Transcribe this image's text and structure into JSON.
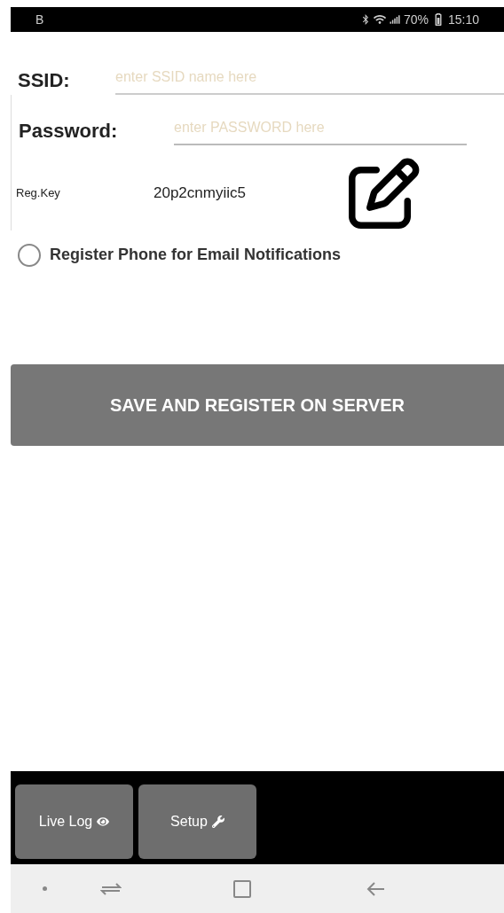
{
  "status_bar": {
    "left": "B",
    "battery": "70%",
    "time": "15:10"
  },
  "form": {
    "ssid": {
      "label": "SSID:",
      "placeholder": "enter SSID name here"
    },
    "password": {
      "label": "Password:",
      "placeholder": "enter PASSWORD here"
    },
    "reg_key": {
      "label": "Reg.Key",
      "value": "20p2cnmyiic5"
    },
    "email_notifications": {
      "label": "Register Phone for Email Notifications",
      "checked": false
    }
  },
  "save_button": "SAVE AND REGISTER ON SERVER",
  "bottom_tabs": [
    {
      "label": "Live Log"
    },
    {
      "label": "Setup"
    }
  ]
}
